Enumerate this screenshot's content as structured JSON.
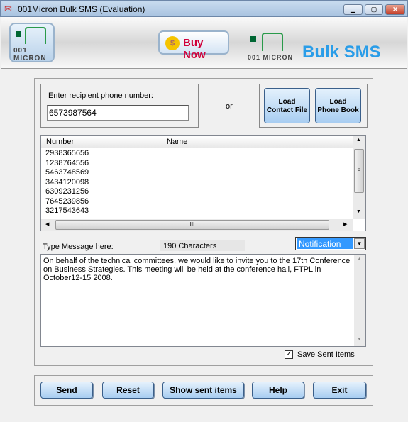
{
  "window": {
    "title": "001Micron Bulk SMS (Evaluation)",
    "controls": [
      "minimize",
      "maximize",
      "close"
    ]
  },
  "header": {
    "logo_text": "001 MICRON",
    "buy_now": "Buy Now",
    "brand": "Bulk SMS"
  },
  "recipient": {
    "label": "Enter recipient phone number:",
    "value": "6573987564"
  },
  "or_label": "or",
  "load_contact_file": [
    "Load",
    "Contact File"
  ],
  "load_phone_book": [
    "Load",
    "Phone Book"
  ],
  "list": {
    "columns": [
      "Number",
      "Name"
    ],
    "rows": [
      "2938365656",
      "1238764556",
      "5463748569",
      "3434120098",
      "6309231256",
      "7645239856",
      "3217543643"
    ]
  },
  "message": {
    "label": "Type Message here:",
    "count": "190 Characters",
    "type_selected": "Notification",
    "text": "On behalf of the technical committees, we would like to invite you to the 17th Conference on Business Strategies. This meeting will be held at the conference hall, FTPL in October12-15 2008."
  },
  "save_sent": {
    "label": "Save Sent Items",
    "checked": true
  },
  "buttons": {
    "send": "Send",
    "reset": "Reset",
    "show": "Show sent items",
    "help": "Help",
    "exit": "Exit"
  }
}
